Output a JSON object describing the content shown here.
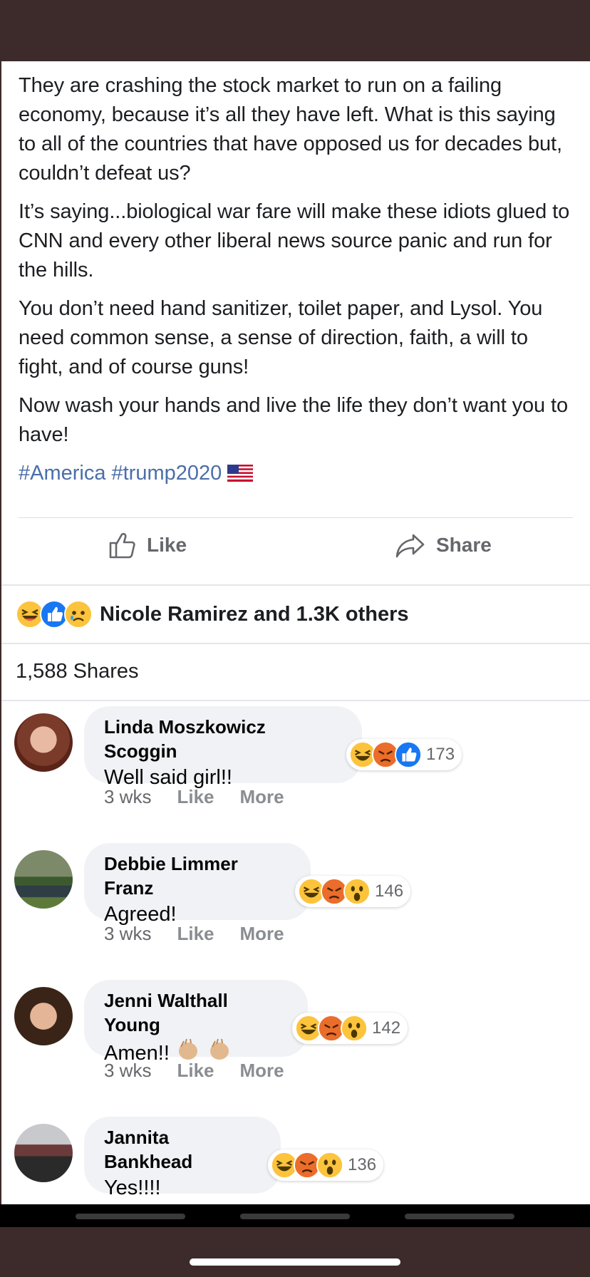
{
  "post": {
    "paragraphs": [
      "They are crashing the stock market to run on a failing economy, because it’s all they have left. What is this saying to all of the countries that have opposed us for decades but, couldn’t defeat us?",
      "It’s saying...biological war fare will make these idiots glued to CNN and every other liberal news source panic and run for the hills.",
      "You don’t need hand sanitizer, toilet paper, and Lysol. You need common sense, a sense of direction, faith, a will to fight, and of course guns!",
      "Now wash your hands and live the life they don’t want you to have!"
    ],
    "hashtags": [
      "#America",
      "#trump2020"
    ],
    "flag_icon": "us-flag-icon"
  },
  "actions": {
    "like_label": "Like",
    "share_label": "Share"
  },
  "reactions": {
    "summary": "Nicole Ramirez and 1.3K others",
    "icons": [
      "haha",
      "like",
      "sad"
    ]
  },
  "shares": {
    "label": "1,588 Shares"
  },
  "comments": [
    {
      "name": "Linda Moszkowicz Scoggin",
      "text": "Well said girl!!",
      "reaction_count": "173",
      "reactions": [
        "haha",
        "angry",
        "like"
      ],
      "time": "3 wks",
      "like": "Like",
      "more": "More"
    },
    {
      "name": "Debbie Limmer Franz",
      "text": "Agreed!",
      "reaction_count": "146",
      "reactions": [
        "haha",
        "angry",
        "wow"
      ],
      "time": "3 wks",
      "like": "Like",
      "more": "More"
    },
    {
      "name": "Jenni Walthall Young",
      "text": "Amen!!",
      "reaction_count": "142",
      "reactions": [
        "haha",
        "angry",
        "wow"
      ],
      "time": "3 wks",
      "like": "Like",
      "more": "More"
    },
    {
      "name": "Jannita Bankhead",
      "text": "Yes!!!!",
      "reaction_count": "136",
      "reactions": [
        "haha",
        "angry",
        "wow"
      ],
      "time": "",
      "like": "",
      "more": ""
    }
  ],
  "colors": {
    "hashtag": "#4b6ea9",
    "bubble": "#f0f2f5",
    "frame": "#3c2b2a",
    "like_blue": "#1877f2"
  }
}
